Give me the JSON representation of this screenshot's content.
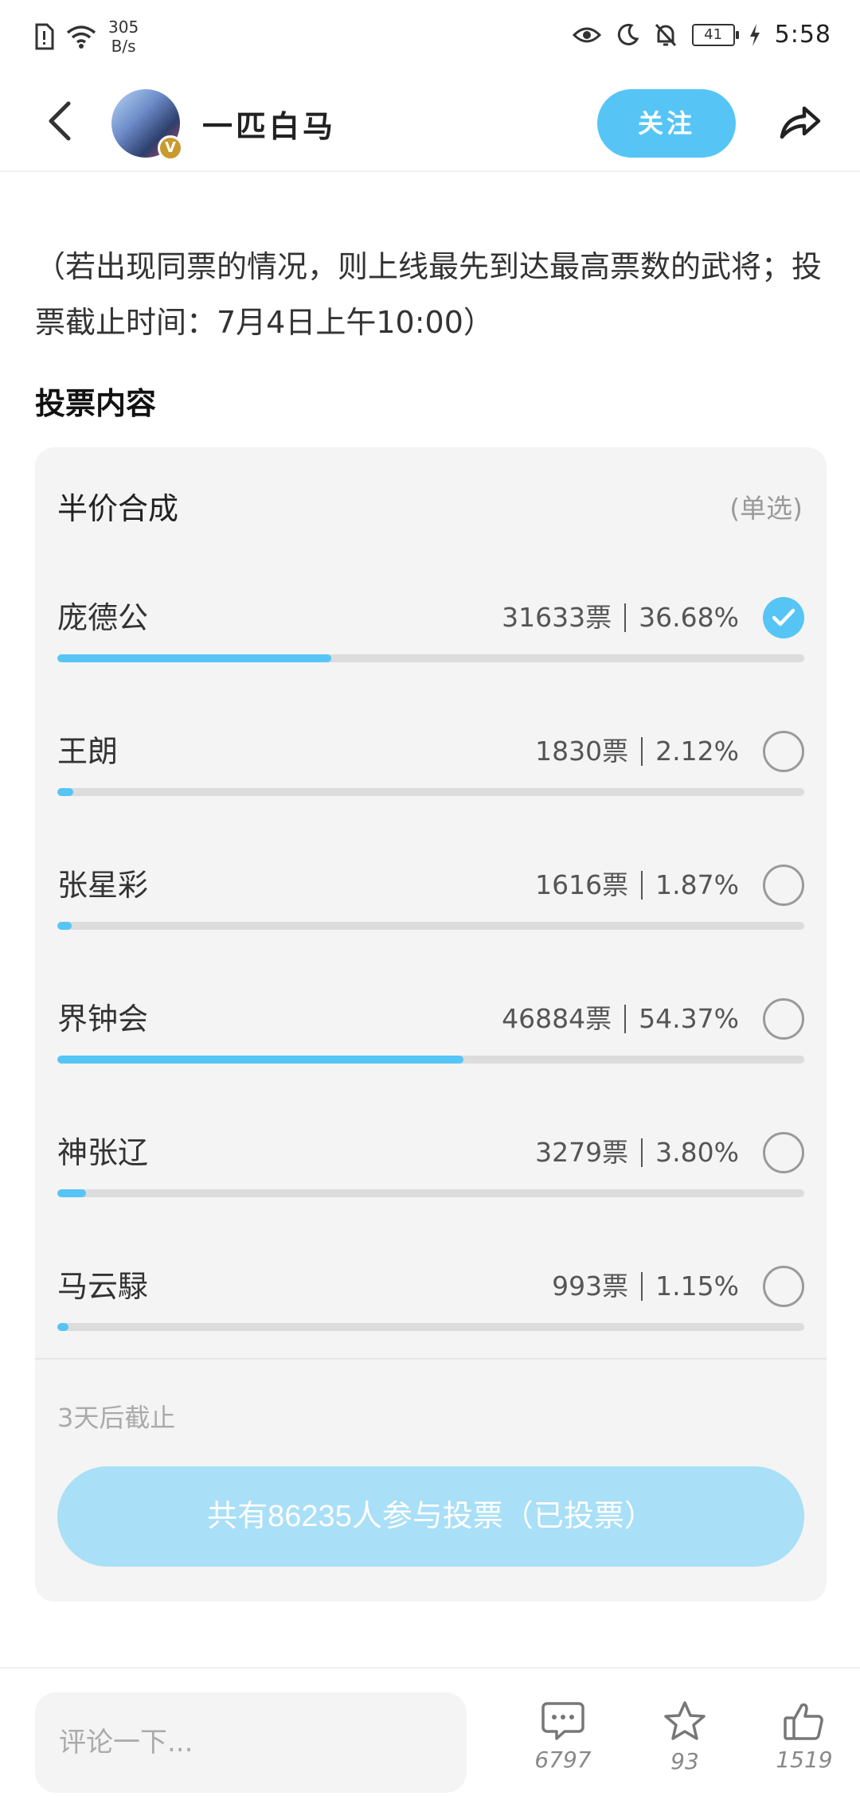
{
  "status_bar": {
    "net_speed_value": "305",
    "net_speed_unit": "B/s",
    "battery": "41",
    "time": "5:58"
  },
  "header": {
    "author_name": "一匹白马",
    "badge_letter": "V",
    "follow_label": "关注"
  },
  "post": {
    "intro_text": "（若出现同票的情况，则上线最先到达最高票数的武将；投票截止时间：7月4日上午10:00）",
    "section_title": "投票内容"
  },
  "vote": {
    "title": "半价合成",
    "mode": "(单选)",
    "options": [
      {
        "name": "庞德公",
        "votes": "31633票",
        "percent": "36.68%",
        "fraction": 0.3668,
        "selected": true
      },
      {
        "name": "王朗",
        "votes": "1830票",
        "percent": "2.12%",
        "fraction": 0.0212,
        "selected": false
      },
      {
        "name": "张星彩",
        "votes": "1616票",
        "percent": "1.87%",
        "fraction": 0.0187,
        "selected": false
      },
      {
        "name": "界钟会",
        "votes": "46884票",
        "percent": "54.37%",
        "fraction": 0.5437,
        "selected": false
      },
      {
        "name": "神张辽",
        "votes": "3279票",
        "percent": "3.80%",
        "fraction": 0.038,
        "selected": false
      },
      {
        "name": "马云騄",
        "votes": "993票",
        "percent": "1.15%",
        "fraction": 0.0115,
        "selected": false
      }
    ],
    "deadline": "3天后截止",
    "status_button": "共有86235人参与投票（已投票）"
  },
  "bottom_bar": {
    "comment_placeholder": "评论一下...",
    "comments_count": "6797",
    "favorites_count": "93",
    "likes_count": "1519"
  },
  "colors": {
    "accent": "#56c5f5",
    "accent_light": "#a9dff7",
    "card_bg": "#f4f4f4"
  },
  "icons": [
    "back-arrow-icon",
    "share-icon",
    "check-icon",
    "comment-icon",
    "star-icon",
    "thumbs-up-icon",
    "eye-icon",
    "moon-icon",
    "bell-off-icon",
    "wifi-icon",
    "sim-alert-icon",
    "charging-icon"
  ]
}
